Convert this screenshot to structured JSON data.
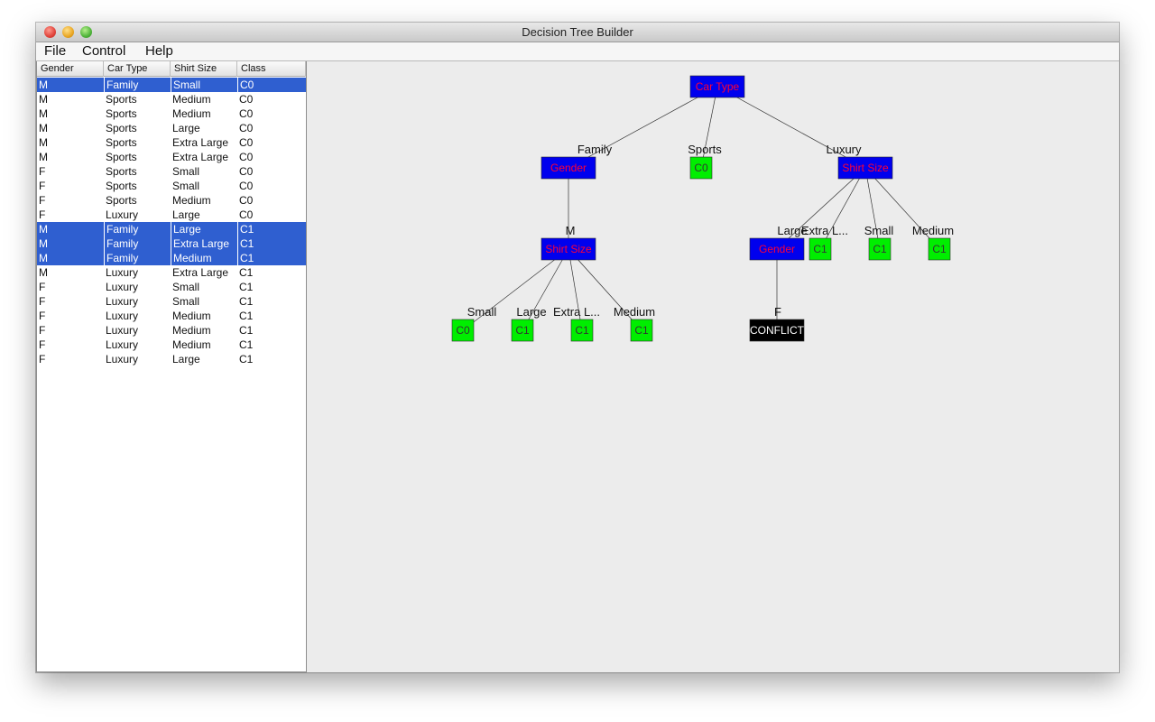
{
  "window": {
    "title": "Decision Tree Builder"
  },
  "menu": [
    {
      "label": "File"
    },
    {
      "label": "Control"
    },
    {
      "label": "Help"
    }
  ],
  "table": {
    "columns": [
      "Gender",
      "Car Type",
      "Shirt Size",
      "Class"
    ],
    "rows": [
      {
        "cells": [
          "M",
          "Family",
          "Small",
          "C0"
        ],
        "selected": true
      },
      {
        "cells": [
          "M",
          "Sports",
          "Medium",
          "C0"
        ],
        "selected": false
      },
      {
        "cells": [
          "M",
          "Sports",
          "Medium",
          "C0"
        ],
        "selected": false
      },
      {
        "cells": [
          "M",
          "Sports",
          "Large",
          "C0"
        ],
        "selected": false
      },
      {
        "cells": [
          "M",
          "Sports",
          "Extra Large",
          "C0"
        ],
        "selected": false
      },
      {
        "cells": [
          "M",
          "Sports",
          "Extra Large",
          "C0"
        ],
        "selected": false
      },
      {
        "cells": [
          "F",
          "Sports",
          "Small",
          "C0"
        ],
        "selected": false
      },
      {
        "cells": [
          "F",
          "Sports",
          "Small",
          "C0"
        ],
        "selected": false
      },
      {
        "cells": [
          "F",
          "Sports",
          "Medium",
          "C0"
        ],
        "selected": false
      },
      {
        "cells": [
          "F",
          "Luxury",
          "Large",
          "C0"
        ],
        "selected": false
      },
      {
        "cells": [
          "M",
          "Family",
          "Large",
          "C1"
        ],
        "selected": true
      },
      {
        "cells": [
          "M",
          "Family",
          "Extra Large",
          "C1"
        ],
        "selected": true
      },
      {
        "cells": [
          "M",
          "Family",
          "Medium",
          "C1"
        ],
        "selected": true
      },
      {
        "cells": [
          "M",
          "Luxury",
          "Extra Large",
          "C1"
        ],
        "selected": false
      },
      {
        "cells": [
          "F",
          "Luxury",
          "Small",
          "C1"
        ],
        "selected": false
      },
      {
        "cells": [
          "F",
          "Luxury",
          "Small",
          "C1"
        ],
        "selected": false
      },
      {
        "cells": [
          "F",
          "Luxury",
          "Medium",
          "C1"
        ],
        "selected": false
      },
      {
        "cells": [
          "F",
          "Luxury",
          "Medium",
          "C1"
        ],
        "selected": false
      },
      {
        "cells": [
          "F",
          "Luxury",
          "Medium",
          "C1"
        ],
        "selected": false
      },
      {
        "cells": [
          "F",
          "Luxury",
          "Large",
          "C1"
        ],
        "selected": false
      }
    ]
  },
  "colors": {
    "split_node_fill": "#0000ee",
    "split_node_text": "#ff0033",
    "leaf_fill": "#00ee00",
    "conflict_fill": "#000000",
    "conflict_text": "#ffffff",
    "selection": "#2f5fd0"
  },
  "tree": {
    "nodes": [
      {
        "id": "n0",
        "type": "split",
        "label": "Car Type"
      },
      {
        "id": "n1",
        "type": "split",
        "label": "Gender",
        "parent": "n0",
        "edge": "Family"
      },
      {
        "id": "n2",
        "type": "leaf",
        "label": "C0",
        "parent": "n0",
        "edge": "Sports"
      },
      {
        "id": "n3",
        "type": "split",
        "label": "Shirt Size",
        "parent": "n0",
        "edge": "Luxury"
      },
      {
        "id": "n4",
        "type": "split",
        "label": "Shirt Size",
        "parent": "n1",
        "edge": "M"
      },
      {
        "id": "n5",
        "type": "leaf",
        "label": "C0",
        "parent": "n4",
        "edge": "Small"
      },
      {
        "id": "n6",
        "type": "leaf",
        "label": "C1",
        "parent": "n4",
        "edge": "Large"
      },
      {
        "id": "n7",
        "type": "leaf",
        "label": "C1",
        "parent": "n4",
        "edge": "Extra L..."
      },
      {
        "id": "n8",
        "type": "leaf",
        "label": "C1",
        "parent": "n4",
        "edge": "Medium"
      },
      {
        "id": "n9",
        "type": "split",
        "label": "Gender",
        "parent": "n3",
        "edge": "Large"
      },
      {
        "id": "n10",
        "type": "leaf",
        "label": "C1",
        "parent": "n3",
        "edge": "Extra L..."
      },
      {
        "id": "n11",
        "type": "leaf",
        "label": "C1",
        "parent": "n3",
        "edge": "Small"
      },
      {
        "id": "n12",
        "type": "leaf",
        "label": "C1",
        "parent": "n3",
        "edge": "Medium"
      },
      {
        "id": "n13",
        "type": "conflict",
        "label": "CONFLICT",
        "parent": "n9",
        "edge": "F"
      }
    ]
  }
}
